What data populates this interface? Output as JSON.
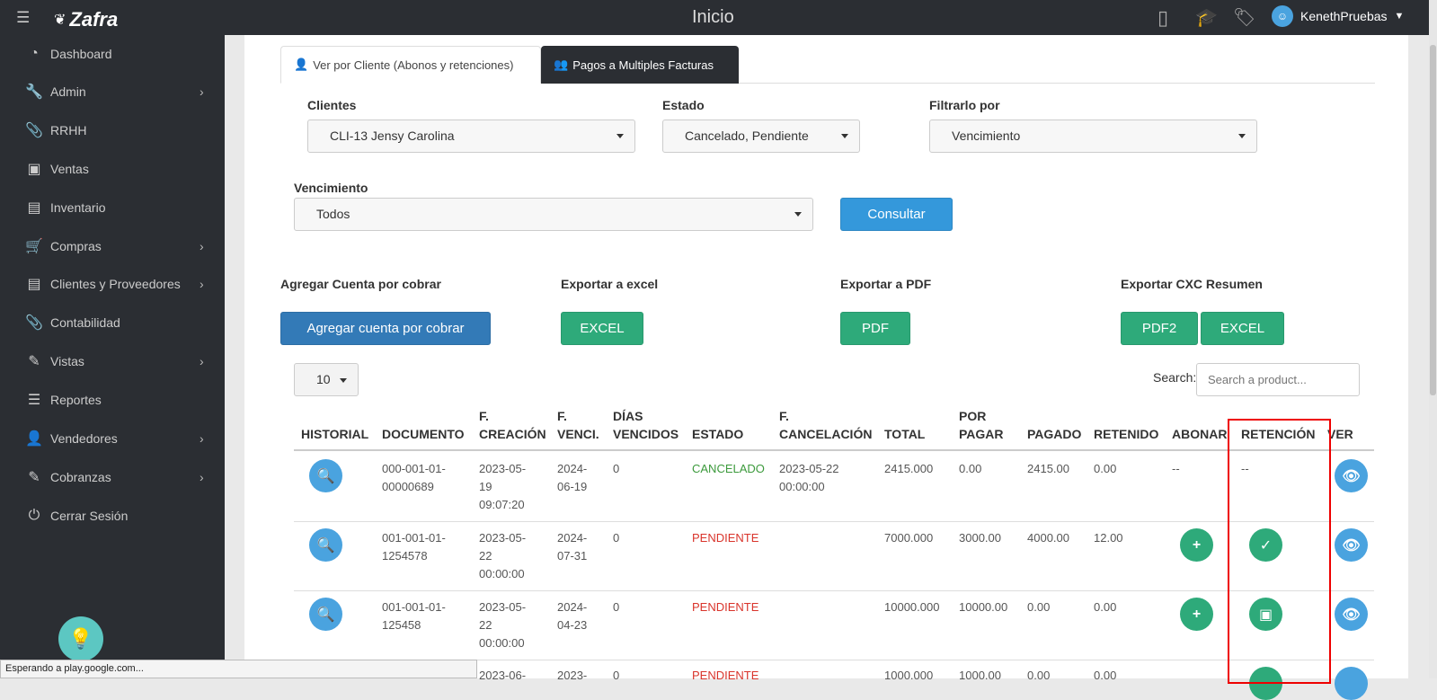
{
  "topbar": {
    "brand": "Zafra",
    "title": "Inicio",
    "user_name": "KenethPruebas"
  },
  "sidebar": {
    "items": [
      {
        "label": "Dashboard",
        "icon": "dashboard-icon",
        "has_submenu": false
      },
      {
        "label": "Admin",
        "icon": "wrench-icon",
        "has_submenu": true
      },
      {
        "label": "RRHH",
        "icon": "paperclip-icon",
        "has_submenu": false
      },
      {
        "label": "Ventas",
        "icon": "money-icon",
        "has_submenu": false
      },
      {
        "label": "Inventario",
        "icon": "book-icon",
        "has_submenu": false
      },
      {
        "label": "Compras",
        "icon": "cart-icon",
        "has_submenu": true
      },
      {
        "label": "Clientes y Proveedores",
        "icon": "book-icon",
        "has_submenu": true
      },
      {
        "label": "Contabilidad",
        "icon": "paperclip-icon",
        "has_submenu": false
      },
      {
        "label": "Vistas",
        "icon": "edit-icon",
        "has_submenu": true
      },
      {
        "label": "Reportes",
        "icon": "list-icon",
        "has_submenu": false
      },
      {
        "label": "Vendedores",
        "icon": "user-icon",
        "has_submenu": true
      },
      {
        "label": "Cobranzas",
        "icon": "edit-icon",
        "has_submenu": true
      },
      {
        "label": "Cerrar Sesión",
        "icon": "power-icon",
        "has_submenu": false
      }
    ]
  },
  "status_bar": "Esperando a play.google.com...",
  "tabs": [
    {
      "label": "Ver por Cliente (Abonos y retenciones)",
      "active": true
    },
    {
      "label": "Pagos a Multiples Facturas",
      "active": false
    }
  ],
  "filters": {
    "clientes_label": "Clientes",
    "clientes_value": "CLI-13 Jensy Carolina",
    "estado_label": "Estado",
    "estado_value": "Cancelado, Pendiente",
    "filtrar_label": "Filtrarlo por",
    "filtrar_value": "Vencimiento",
    "vencimiento_label": "Vencimiento",
    "vencimiento_value": "Todos",
    "consultar_label": "Consultar"
  },
  "actions": {
    "agregar_label": "Agregar Cuenta por cobrar",
    "agregar_button": "Agregar cuenta por cobrar",
    "excel_label": "Exportar a excel",
    "excel_button": "EXCEL",
    "pdf_label": "Exportar a PDF",
    "pdf_button": "PDF",
    "cxc_label": "Exportar CXC Resumen",
    "cxc_pdf_button": "PDF2",
    "cxc_excel_button": "EXCEL"
  },
  "table_controls": {
    "page_size": "10",
    "search_label": "Search:",
    "search_placeholder": "Search a product..."
  },
  "table": {
    "headers": {
      "historial": "HISTORIAL",
      "documento": "DOCUMENTO",
      "f_creacion_1": "F.",
      "f_creacion_2": "CREACIÓN",
      "f_venci_1": "F.",
      "f_venci_2": "VENCI.",
      "dias_1": "DÍAS",
      "dias_2": "VENCIDOS",
      "estado": "ESTADO",
      "f_cancel_1": "F.",
      "f_cancel_2": "CANCELACIÓN",
      "total": "TOTAL",
      "por_pagar_1": "POR",
      "por_pagar_2": "PAGAR",
      "pagado": "PAGADO",
      "retenido": "RETENIDO",
      "abonar": "ABONAR",
      "retencion": "RETENCIÓN",
      "ver": "VER"
    },
    "rows": [
      {
        "doc1": "000-001-01-",
        "doc2": "00000689",
        "cre1": "2023-05-",
        "cre2": "19",
        "cre3": "09:07:20",
        "ven1": "2024-",
        "ven2": "06-19",
        "dias": "0",
        "estado": "CANCELADO",
        "can1": "2023-05-22",
        "can2": "00:00:00",
        "total": "2415.000",
        "por_pagar": "0.00",
        "pagado": "2415.00",
        "retenido": "0.00",
        "abonar": "--",
        "retencion": "--"
      },
      {
        "doc1": "001-001-01-",
        "doc2": "1254578",
        "cre1": "2023-05-",
        "cre2": "22",
        "cre3": "00:00:00",
        "ven1": "2024-",
        "ven2": "07-31",
        "dias": "0",
        "estado": "PENDIENTE",
        "can1": "",
        "can2": "",
        "total": "7000.000",
        "por_pagar": "3000.00",
        "pagado": "4000.00",
        "retenido": "12.00",
        "abonar": "",
        "retencion": ""
      },
      {
        "doc1": "001-001-01-",
        "doc2": "125458",
        "cre1": "2023-05-",
        "cre2": "22",
        "cre3": "00:00:00",
        "ven1": "2024-",
        "ven2": "04-23",
        "dias": "0",
        "estado": "PENDIENTE",
        "can1": "",
        "can2": "",
        "total": "10000.000",
        "por_pagar": "10000.00",
        "pagado": "0.00",
        "retenido": "0.00",
        "abonar": "",
        "retencion": ""
      },
      {
        "doc1": "",
        "doc2": "",
        "cre1": "2023-06-",
        "cre2": "",
        "cre3": "",
        "ven1": "2023-",
        "ven2": "",
        "dias": "0",
        "estado": "PENDIENTE",
        "can1": "",
        "can2": "",
        "total": "1000.000",
        "por_pagar": "1000.00",
        "pagado": "0.00",
        "retenido": "0.00",
        "abonar": "",
        "retencion": ""
      }
    ]
  },
  "colors": {
    "sidebar_bg": "#2b2e33",
    "primary": "#3498db",
    "success": "#2eaa7a",
    "danger": "#d9342b",
    "highlight_box": "#e00000"
  }
}
